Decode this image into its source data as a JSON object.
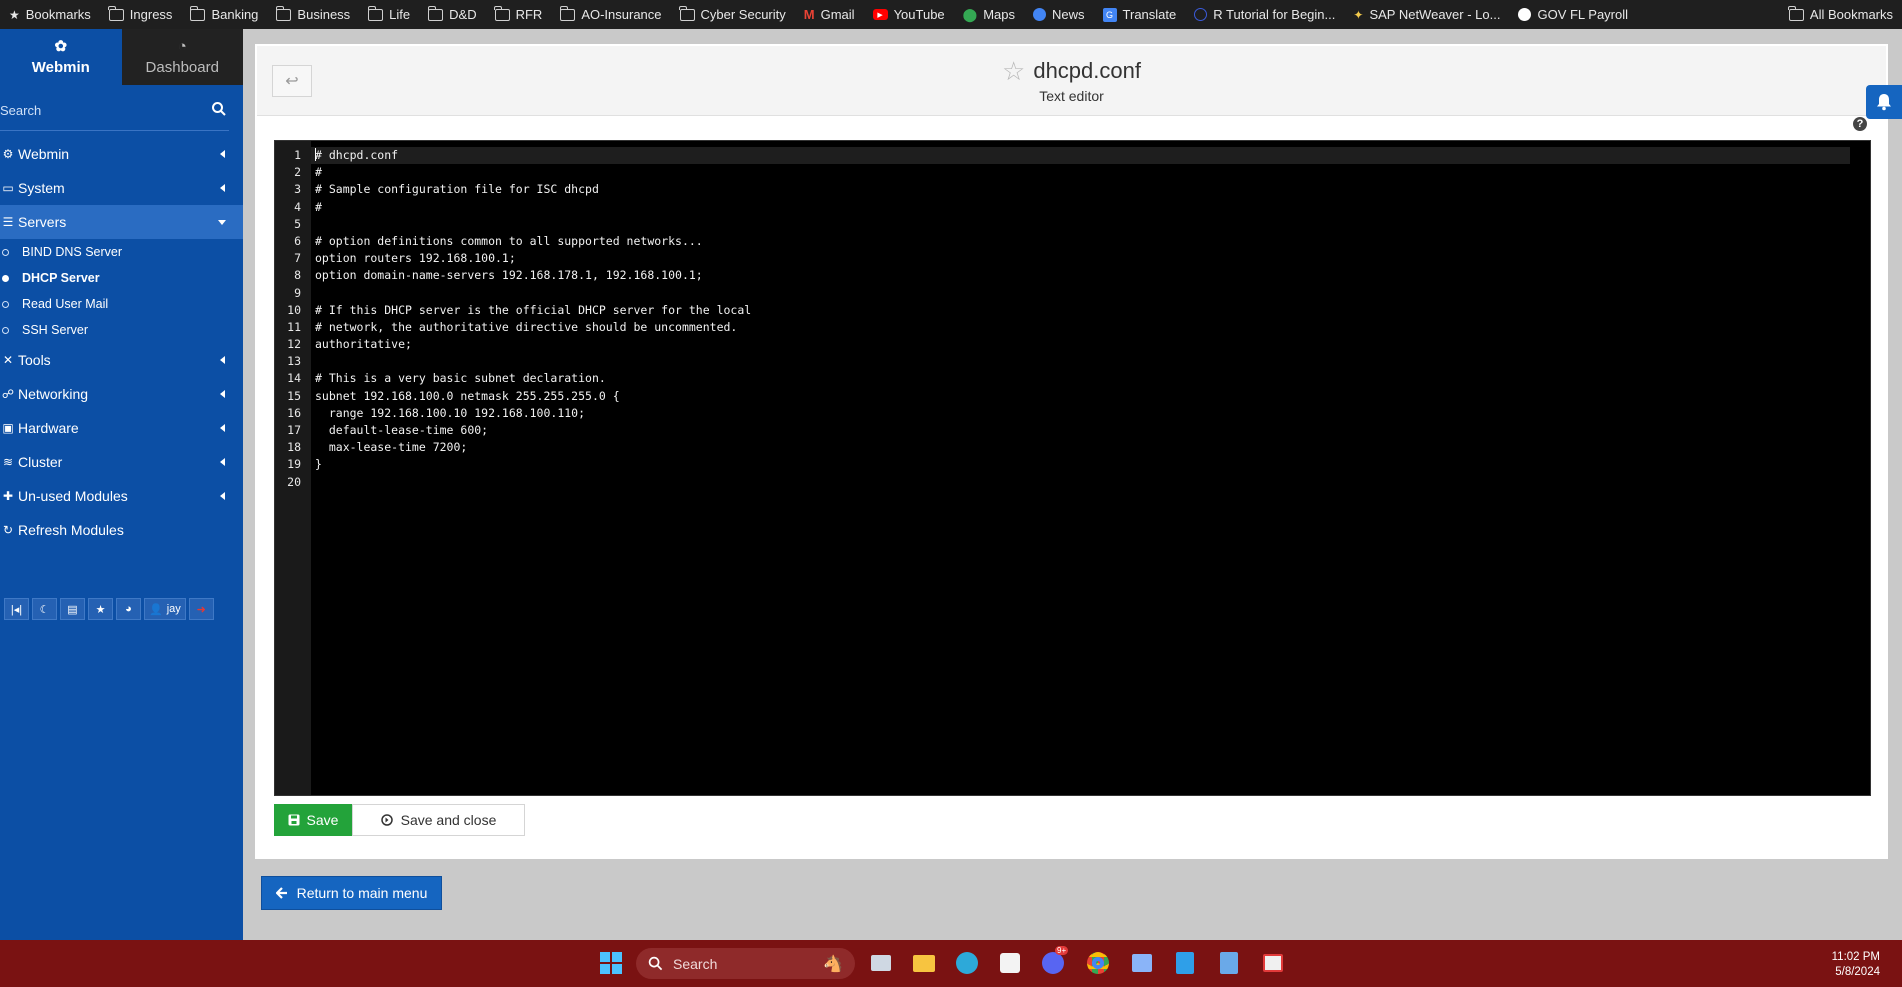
{
  "bookmarks_bar": {
    "items": [
      {
        "label": "Bookmarks",
        "icon": "star-icon"
      },
      {
        "label": "Ingress",
        "icon": "folder-icon"
      },
      {
        "label": "Banking",
        "icon": "folder-icon"
      },
      {
        "label": "Business",
        "icon": "folder-icon"
      },
      {
        "label": "Life",
        "icon": "folder-icon"
      },
      {
        "label": "D&D",
        "icon": "folder-icon"
      },
      {
        "label": "RFR",
        "icon": "folder-icon"
      },
      {
        "label": "AO-Insurance",
        "icon": "folder-icon"
      },
      {
        "label": "Cyber Security",
        "icon": "folder-icon"
      },
      {
        "label": "Gmail",
        "icon": "gmail-icon",
        "color": "#ea4335"
      },
      {
        "label": "YouTube",
        "icon": "youtube-icon",
        "color": "#ff0000"
      },
      {
        "label": "Maps",
        "icon": "maps-icon",
        "color": "#34a853"
      },
      {
        "label": "News",
        "icon": "news-icon",
        "color": "#4285f4"
      },
      {
        "label": "Translate",
        "icon": "translate-icon",
        "color": "#4285f4"
      },
      {
        "label": "R Tutorial for Begin...",
        "icon": "r-tutorial-icon",
        "color": "#3b5bdb"
      },
      {
        "label": "SAP NetWeaver - Lo...",
        "icon": "sap-icon",
        "color": "#f2c94c"
      },
      {
        "label": "GOV FL Payroll",
        "icon": "globe-icon",
        "color": "#ffffff"
      }
    ],
    "all_bookmarks": "All Bookmarks"
  },
  "sidebar": {
    "tabs": [
      {
        "label": "Webmin",
        "icon": "webmin-logo-icon"
      },
      {
        "label": "Dashboard",
        "icon": "dashboard-gauge-icon"
      }
    ],
    "search_placeholder": "Search",
    "menu": [
      {
        "label": "Webmin",
        "icon": "gear-icon"
      },
      {
        "label": "System",
        "icon": "monitor-icon"
      },
      {
        "label": "Servers",
        "icon": "servers-icon",
        "open": true
      },
      {
        "label": "Tools",
        "icon": "tools-icon"
      },
      {
        "label": "Networking",
        "icon": "network-icon"
      },
      {
        "label": "Hardware",
        "icon": "hardware-icon"
      },
      {
        "label": "Cluster",
        "icon": "cluster-icon"
      },
      {
        "label": "Un-used Modules",
        "icon": "puzzle-icon"
      },
      {
        "label": "Refresh Modules",
        "icon": "refresh-icon"
      }
    ],
    "servers_submenu": [
      {
        "label": "BIND DNS Server"
      },
      {
        "label": "DHCP Server",
        "active": true
      },
      {
        "label": "Read User Mail"
      },
      {
        "label": "SSH Server"
      }
    ],
    "toolbar": {
      "user_label": "jay"
    }
  },
  "header": {
    "title": "dhcpd.conf",
    "subtitle": "Text editor"
  },
  "editor": {
    "lines": [
      "# dhcpd.conf",
      "#",
      "# Sample configuration file for ISC dhcpd",
      "#",
      "",
      "# option definitions common to all supported networks...",
      "option routers 192.168.100.1;",
      "option domain-name-servers 192.168.178.1, 192.168.100.1;",
      "",
      "# If this DHCP server is the official DHCP server for the local",
      "# network, the authoritative directive should be uncommented.",
      "authoritative;",
      "",
      "# This is a very basic subnet declaration.",
      "subnet 192.168.100.0 netmask 255.255.255.0 {",
      "  range 192.168.100.10 192.168.100.110;",
      "  default-lease-time 600;",
      "  max-lease-time 7200;",
      "}",
      ""
    ]
  },
  "buttons": {
    "save": "Save",
    "save_close": "Save and close",
    "return": "Return to main menu"
  },
  "taskbar": {
    "search_placeholder": "Search",
    "time": "11:02 PM",
    "date": "5/8/2024",
    "chat_badge": "9+"
  },
  "colors": {
    "sidebar": "#0c4fa5",
    "save_button": "#23a33a",
    "return_button": "#1565c0",
    "taskbar": "#7a1212"
  }
}
